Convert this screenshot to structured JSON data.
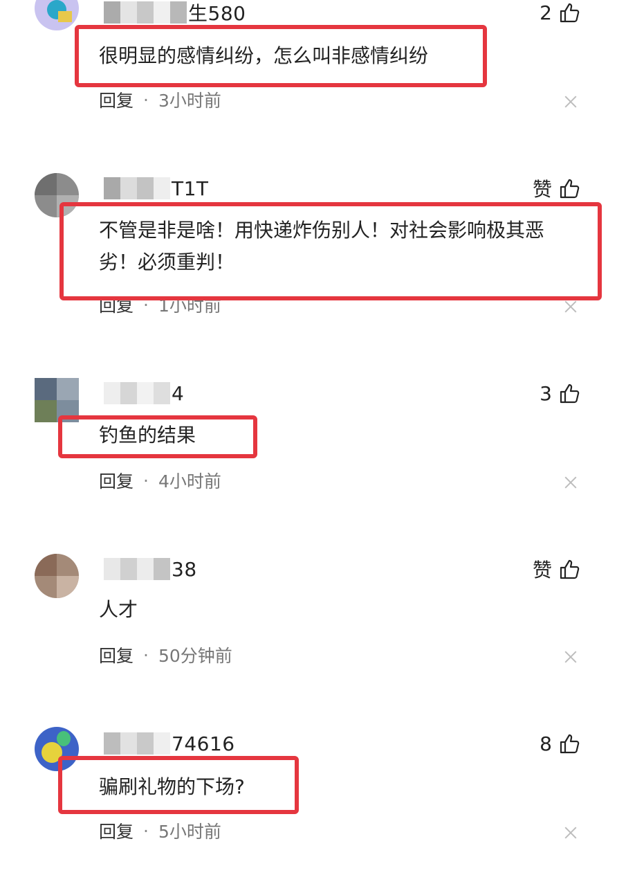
{
  "comments": [
    {
      "username_suffix": "生580",
      "likes": "2",
      "text": "很明显的感情纠纷，怎么叫非感情纠纷",
      "reply_label": "回复",
      "separator": "·",
      "time": "3小时前"
    },
    {
      "username_suffix": "T1T",
      "likes": "赞",
      "text": "不管是非是啥！用快递炸伤别人！对社会影响极其恶劣！必须重判！",
      "reply_label": "回复",
      "separator": "·",
      "time": "1小时前"
    },
    {
      "username_suffix": "4",
      "likes": "3",
      "text": "钓鱼的结果",
      "reply_label": "回复",
      "separator": "·",
      "time": "4小时前"
    },
    {
      "username_suffix": "38",
      "likes": "赞",
      "text": "人才",
      "reply_label": "回复",
      "separator": "·",
      "time": "50分钟前"
    },
    {
      "username_suffix": "74616",
      "likes": "8",
      "text": "骗刷礼物的下场?",
      "reply_label": "回复",
      "separator": "·",
      "time": "5小时前"
    }
  ],
  "colors": {
    "highlight": "#e5363f",
    "text": "#222222",
    "meta": "#777777"
  }
}
